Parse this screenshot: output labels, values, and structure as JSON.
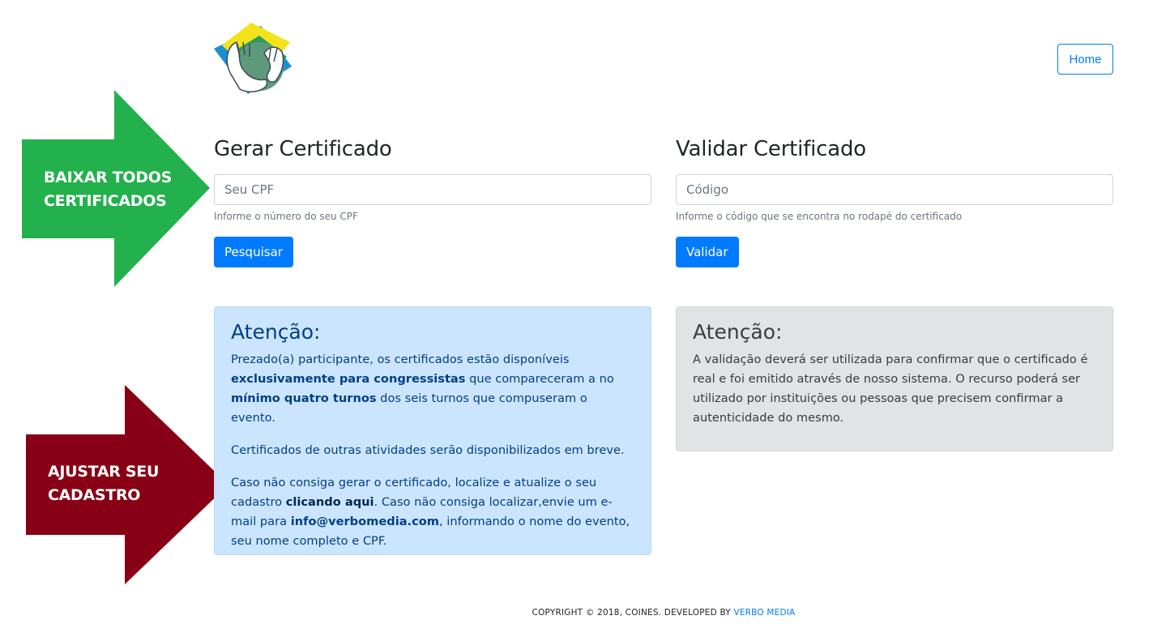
{
  "header": {
    "logo_name": "coines-logo",
    "home_label": "Home"
  },
  "generate": {
    "title": "Gerar Certificado",
    "input_placeholder": "Seu CPF",
    "input_value": "",
    "hint": "Informe o número do seu CPF",
    "button_label": "Pesquisar"
  },
  "validate": {
    "title": "Validar Certificado",
    "input_placeholder": "Código",
    "input_value": "",
    "hint": "Informe o código que se encontra no rodapé do certificado",
    "button_label": "Validar"
  },
  "alert_generate": {
    "title": "Atenção:",
    "p1_a": "Prezado(a) participante, os certificados estão disponíveis ",
    "p1_b": "exclusivamente para congressistas",
    "p1_c": " que compareceram a no ",
    "p1_d": "mínimo quatro turnos",
    "p1_e": " dos seis turnos que compuseram o evento.",
    "p2": "Certificados de outras atividades serão disponibilizados em breve.",
    "p3_a": "Caso não consiga gerar o certificado, localize e atualize o seu cadastro ",
    "p3_link": "clicando aqui",
    "p3_b": ". Caso não consiga localizar,envie um e-mail para ",
    "p3_email": "info@verbomedia.com",
    "p3_c": ", informando o nome do evento, seu nome completo e CPF."
  },
  "alert_validate": {
    "title": "Atenção:",
    "text": "A validação deverá ser utilizada para confirmar que o certificado é real e foi emitido através de nosso sistema. O recurso poderá ser utilizado por instituições ou pessoas que precisem confirmar a autenticidade do mesmo."
  },
  "annotations": {
    "green_arrow": {
      "line1": "BAIXAR TODOS",
      "line2": "CERTIFICADOS",
      "color": "#22b14c"
    },
    "red_arrow": {
      "line1": "AJUSTAR SEU",
      "line2": "CADASTRO",
      "color": "#880015"
    }
  },
  "footer": {
    "copyright": "COPYRIGHT © 2018, COINES. DEVELOPED BY ",
    "developer": "VERBO MEDIA"
  },
  "colors": {
    "primary": "#007bff",
    "info_bg": "#cce5ff",
    "info_text": "#004085",
    "gray_bg": "#e2e3e5"
  }
}
